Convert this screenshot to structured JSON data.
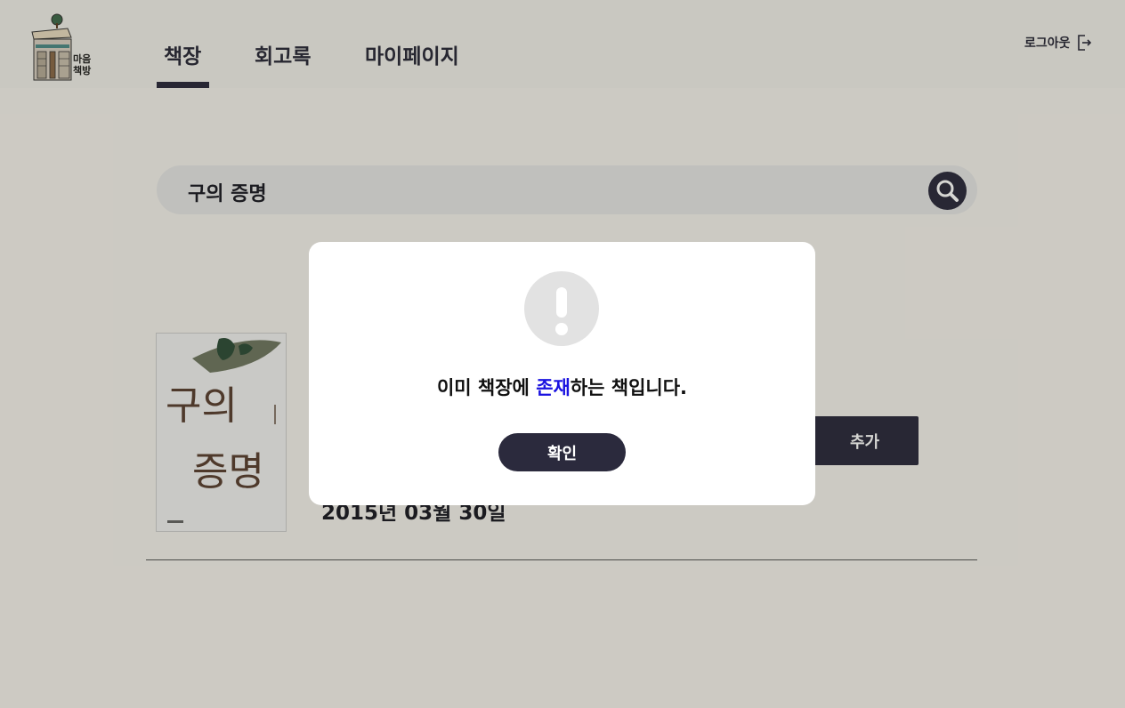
{
  "header": {
    "logo_text_line1": "마음",
    "logo_text_line2": "책방",
    "tabs": [
      {
        "label": "책장"
      },
      {
        "label": "회고록"
      },
      {
        "label": "마이페이지"
      }
    ],
    "active_tab": "책장",
    "logout_label": "로그아웃"
  },
  "search": {
    "query": "구의 증명"
  },
  "result": {
    "book_cover_title_top": "구의",
    "book_cover_title_bottom": "증명",
    "date": "2015년 03월 30일",
    "add_label": "추가"
  },
  "modal": {
    "message_before": "이미 책장에 ",
    "message_highlight": "존재",
    "message_after": "하는 책입니다.",
    "confirm_label": "확인",
    "highlight_color": "#1a12e0"
  },
  "colors": {
    "primary": "#2b2a3d",
    "background": "#f3f1ec"
  }
}
